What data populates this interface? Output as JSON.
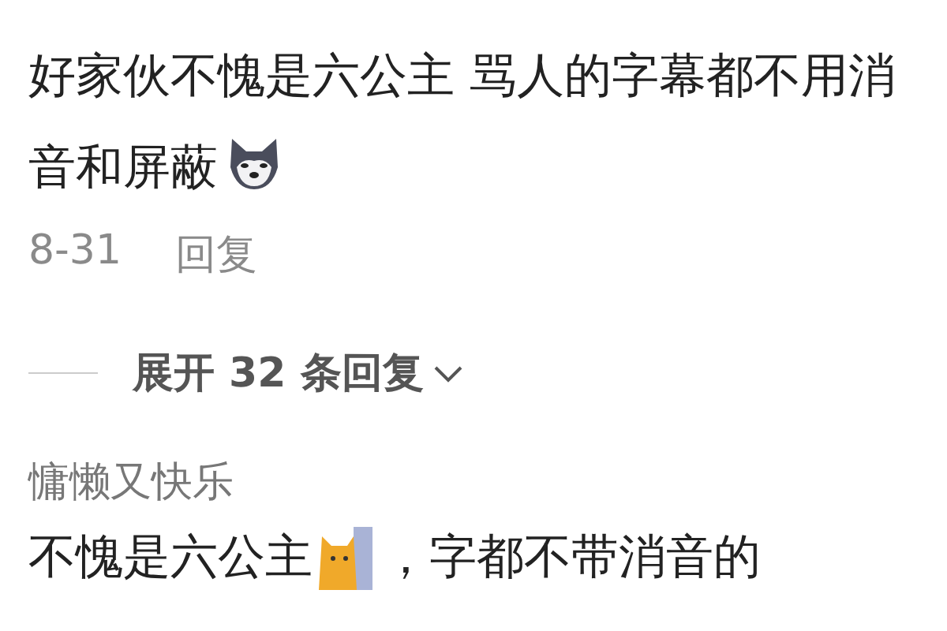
{
  "comments": [
    {
      "text": "好家伙不愧是六公主 骂人的字幕都不用消音和屏蔽",
      "emoji": {
        "kind": "dog"
      },
      "date": "8-31",
      "reply": "回复"
    },
    {
      "expand": "展开 32 条回复",
      "author": "慵懒又快乐",
      "text_before": "不愧是六公主",
      "emoji": {
        "kind": "cat"
      },
      "text_after": "，字都不带消音的"
    }
  ]
}
